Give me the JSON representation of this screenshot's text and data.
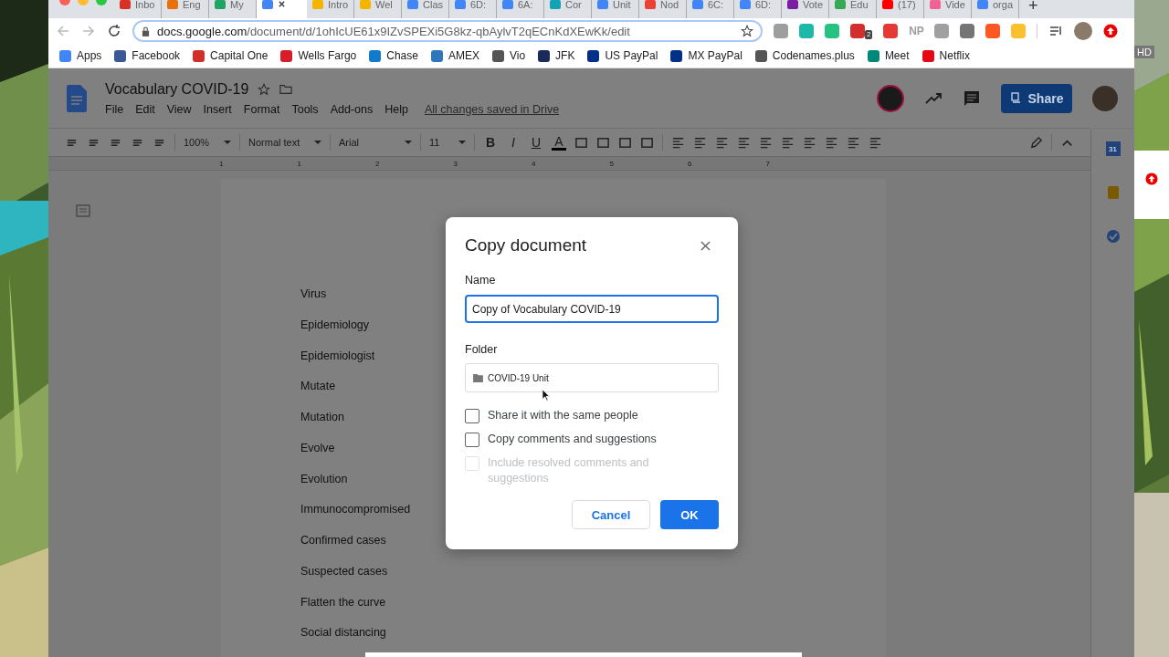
{
  "browser": {
    "tabs": [
      {
        "title": "Inbo",
        "selected": false,
        "color": "#d93025"
      },
      {
        "title": "Eng",
        "selected": false,
        "color": "#e8710a"
      },
      {
        "title": "My",
        "selected": false,
        "color": "#1fa463"
      },
      {
        "selected": true,
        "color": "#4285f4"
      },
      {
        "title": "Intro",
        "selected": false,
        "color": "#f4b400"
      },
      {
        "title": "Wel",
        "selected": false,
        "color": "#f4b400"
      },
      {
        "title": "Clas",
        "selected": false,
        "color": "#4285f4"
      },
      {
        "title": "6D:",
        "selected": false,
        "color": "#4285f4"
      },
      {
        "title": "6A:",
        "selected": false,
        "color": "#4285f4"
      },
      {
        "title": "Cor",
        "selected": false,
        "color": "#12a4b4"
      },
      {
        "title": "Unit",
        "selected": false,
        "color": "#4285f4"
      },
      {
        "title": "Nod",
        "selected": false,
        "color": "#ea4335"
      },
      {
        "title": "6C:",
        "selected": false,
        "color": "#4285f4"
      },
      {
        "title": "6D:",
        "selected": false,
        "color": "#4285f4"
      },
      {
        "title": "Vote",
        "selected": false,
        "color": "#7b1fa2"
      },
      {
        "title": "Edu",
        "selected": false,
        "color": "#34a853"
      },
      {
        "title": "(17)",
        "selected": false,
        "color": "#ff0000"
      },
      {
        "title": "Vide",
        "selected": false,
        "color": "#f06292"
      },
      {
        "title": "orga",
        "selected": false,
        "color": "#4285f4"
      }
    ],
    "new_tab": "+",
    "address": {
      "host": "docs.google.com",
      "path": "/document/d/1ohIcUE61x9IZvSPEXi5G8kz-qbAylvT2qECnKdXEwKk/edit"
    },
    "extensions": [
      {
        "color": "#9e9e9e"
      },
      {
        "color": "#1db9a8"
      },
      {
        "color": "#26c281"
      },
      {
        "color": "#d32f2f",
        "badge": "2"
      },
      {
        "color": "#e53935"
      },
      {
        "color": "#9e9e9e",
        "text": "NP"
      },
      {
        "color": "#a0a0a0"
      },
      {
        "color": "#757575"
      },
      {
        "color": "#ff5722"
      },
      {
        "color": "#fbc02d"
      }
    ],
    "bookmarks": [
      {
        "label": "Apps",
        "color": "#4285f4"
      },
      {
        "label": "Facebook",
        "color": "#3b5998"
      },
      {
        "label": "Capital One",
        "color": "#d03027"
      },
      {
        "label": "Wells Fargo",
        "color": "#d71e28"
      },
      {
        "label": "Chase",
        "color": "#117aca"
      },
      {
        "label": "AMEX",
        "color": "#2e77bc"
      },
      {
        "label": "Vio",
        "color": "#555555"
      },
      {
        "label": "JFK",
        "color": "#1a2a5a"
      },
      {
        "label": "US PayPal",
        "color": "#003087"
      },
      {
        "label": "MX PayPal",
        "color": "#003087"
      },
      {
        "label": "Codenames.plus",
        "color": "#555555"
      },
      {
        "label": "Meet",
        "color": "#00897b"
      },
      {
        "label": "Netflix",
        "color": "#e50914"
      }
    ]
  },
  "docs": {
    "title": "Vocabulary COVID-19",
    "menu": [
      "File",
      "Edit",
      "View",
      "Insert",
      "Format",
      "Tools",
      "Add-ons",
      "Help"
    ],
    "saved_status": "All changes saved in Drive",
    "share": "Share",
    "toolbar": {
      "zoom": "100%",
      "style": "Normal text",
      "font": "Arial",
      "size": "11",
      "format": [
        "B",
        "I",
        "U",
        "A"
      ]
    },
    "ruler": [
      "1",
      "1",
      "2",
      "3",
      "4",
      "5",
      "6",
      "7"
    ],
    "lines": [
      "Virus",
      "Epidemiology",
      "Epidemiologist",
      "Mutate",
      "Mutation",
      "Evolve",
      "Evolution",
      "Immunocompromised",
      "Confirmed cases",
      "Suspected cases",
      "Flatten the curve",
      "Social distancing"
    ],
    "side_calendar": "31"
  },
  "dialog": {
    "title": "Copy document",
    "name_label": "Name",
    "name_value": "Copy of Vocabulary COVID-19",
    "folder_label": "Folder",
    "folder_value": "COVID-19 Unit",
    "options": [
      {
        "label": "Share it with the same people",
        "checked": false,
        "disabled": false
      },
      {
        "label": "Copy comments and suggestions",
        "checked": false,
        "disabled": false
      },
      {
        "label": "Include resolved comments and suggestions",
        "checked": false,
        "disabled": true
      }
    ],
    "cancel": "Cancel",
    "ok": "OK"
  },
  "hd_badge": "HD"
}
